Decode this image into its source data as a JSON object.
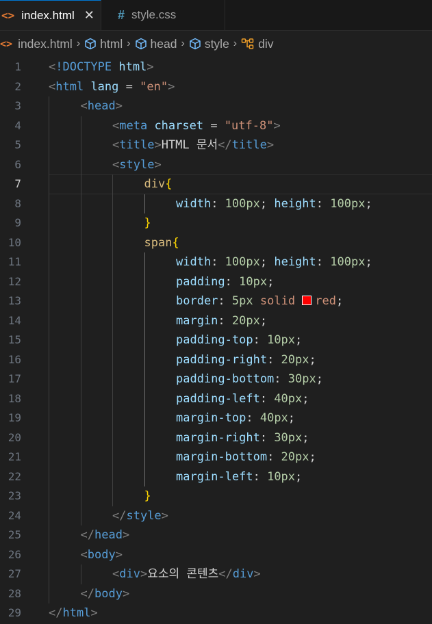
{
  "tabs": [
    {
      "label": "index.html",
      "icon": "html-file-icon",
      "active": true,
      "close": "✕"
    },
    {
      "label": "style.css",
      "icon": "css-file-icon",
      "active": false
    }
  ],
  "breadcrumb": [
    "index.html",
    "html",
    "head",
    "style",
    "div"
  ],
  "colors": {
    "html_icon": "#e37933",
    "css_icon": "#519aba",
    "swatch": "#ff0000"
  },
  "current_line": 7,
  "lines": [
    {
      "n": "1",
      "indent": 0,
      "tokens": [
        [
          "punc",
          "<"
        ],
        [
          "tag",
          "!DOCTYPE "
        ],
        [
          "attr",
          "html"
        ],
        [
          "punc",
          ">"
        ]
      ]
    },
    {
      "n": "2",
      "indent": 0,
      "tokens": [
        [
          "punc",
          "<"
        ],
        [
          "tag",
          "html "
        ],
        [
          "attr",
          "lang"
        ],
        [
          "plain",
          " = "
        ],
        [
          "str",
          "\"en\""
        ],
        [
          "punc",
          ">"
        ]
      ]
    },
    {
      "n": "3",
      "indent": 1,
      "tokens": [
        [
          "punc",
          "<"
        ],
        [
          "tag",
          "head"
        ],
        [
          "punc",
          ">"
        ]
      ]
    },
    {
      "n": "4",
      "indent": 2,
      "tokens": [
        [
          "punc",
          "<"
        ],
        [
          "tag",
          "meta "
        ],
        [
          "attr",
          "charset"
        ],
        [
          "plain",
          " = "
        ],
        [
          "str",
          "\"utf-8\""
        ],
        [
          "punc",
          ">"
        ]
      ]
    },
    {
      "n": "5",
      "indent": 2,
      "tokens": [
        [
          "punc",
          "<"
        ],
        [
          "tag",
          "title"
        ],
        [
          "punc",
          ">"
        ],
        [
          "text",
          "HTML 문서"
        ],
        [
          "punc",
          "</"
        ],
        [
          "tag",
          "title"
        ],
        [
          "punc",
          ">"
        ]
      ]
    },
    {
      "n": "6",
      "indent": 2,
      "tokens": [
        [
          "punc",
          "<"
        ],
        [
          "tag",
          "style"
        ],
        [
          "punc",
          ">"
        ]
      ]
    },
    {
      "n": "7",
      "indent": 3,
      "tokens": [
        [
          "sel",
          "div"
        ],
        [
          "brace",
          "{"
        ]
      ]
    },
    {
      "n": "8",
      "indent": 4,
      "tokens": [
        [
          "prop",
          "width"
        ],
        [
          "plain",
          ": "
        ],
        [
          "num",
          "100px"
        ],
        [
          "plain",
          "; "
        ],
        [
          "prop",
          "height"
        ],
        [
          "plain",
          ": "
        ],
        [
          "num",
          "100px"
        ],
        [
          "plain",
          ";"
        ]
      ]
    },
    {
      "n": "9",
      "indent": 3,
      "tokens": [
        [
          "brace",
          "}"
        ]
      ]
    },
    {
      "n": "10",
      "indent": 3,
      "tokens": [
        [
          "sel",
          "span"
        ],
        [
          "brace",
          "{"
        ]
      ]
    },
    {
      "n": "11",
      "indent": 4,
      "tokens": [
        [
          "prop",
          "width"
        ],
        [
          "plain",
          ": "
        ],
        [
          "num",
          "100px"
        ],
        [
          "plain",
          "; "
        ],
        [
          "prop",
          "height"
        ],
        [
          "plain",
          ": "
        ],
        [
          "num",
          "100px"
        ],
        [
          "plain",
          ";"
        ]
      ]
    },
    {
      "n": "12",
      "indent": 4,
      "tokens": [
        [
          "prop",
          "padding"
        ],
        [
          "plain",
          ": "
        ],
        [
          "num",
          "10px"
        ],
        [
          "plain",
          ";"
        ]
      ]
    },
    {
      "n": "13",
      "indent": 4,
      "tokens": [
        [
          "prop",
          "border"
        ],
        [
          "plain",
          ": "
        ],
        [
          "num",
          "5px"
        ],
        [
          "plain",
          " "
        ],
        [
          "val",
          "solid "
        ],
        [
          "swatch",
          ""
        ],
        [
          "val",
          "red"
        ],
        [
          "plain",
          ";"
        ]
      ]
    },
    {
      "n": "14",
      "indent": 4,
      "tokens": [
        [
          "prop",
          "margin"
        ],
        [
          "plain",
          ": "
        ],
        [
          "num",
          "20px"
        ],
        [
          "plain",
          ";"
        ]
      ]
    },
    {
      "n": "15",
      "indent": 4,
      "tokens": [
        [
          "prop",
          "padding-top"
        ],
        [
          "plain",
          ": "
        ],
        [
          "num",
          "10px"
        ],
        [
          "plain",
          ";"
        ]
      ]
    },
    {
      "n": "16",
      "indent": 4,
      "tokens": [
        [
          "prop",
          "padding-right"
        ],
        [
          "plain",
          ": "
        ],
        [
          "num",
          "20px"
        ],
        [
          "plain",
          ";"
        ]
      ]
    },
    {
      "n": "17",
      "indent": 4,
      "tokens": [
        [
          "prop",
          "padding-bottom"
        ],
        [
          "plain",
          ": "
        ],
        [
          "num",
          "30px"
        ],
        [
          "plain",
          ";"
        ]
      ]
    },
    {
      "n": "18",
      "indent": 4,
      "tokens": [
        [
          "prop",
          "padding-left"
        ],
        [
          "plain",
          ": "
        ],
        [
          "num",
          "40px"
        ],
        [
          "plain",
          ";"
        ]
      ]
    },
    {
      "n": "19",
      "indent": 4,
      "tokens": [
        [
          "prop",
          "margin-top"
        ],
        [
          "plain",
          ": "
        ],
        [
          "num",
          "40px"
        ],
        [
          "plain",
          ";"
        ]
      ]
    },
    {
      "n": "20",
      "indent": 4,
      "tokens": [
        [
          "prop",
          "margin-right"
        ],
        [
          "plain",
          ": "
        ],
        [
          "num",
          "30px"
        ],
        [
          "plain",
          ";"
        ]
      ]
    },
    {
      "n": "21",
      "indent": 4,
      "tokens": [
        [
          "prop",
          "margin-bottom"
        ],
        [
          "plain",
          ": "
        ],
        [
          "num",
          "20px"
        ],
        [
          "plain",
          ";"
        ]
      ]
    },
    {
      "n": "22",
      "indent": 4,
      "tokens": [
        [
          "prop",
          "margin-left"
        ],
        [
          "plain",
          ": "
        ],
        [
          "num",
          "10px"
        ],
        [
          "plain",
          ";"
        ]
      ]
    },
    {
      "n": "23",
      "indent": 3,
      "tokens": [
        [
          "brace",
          "}"
        ]
      ]
    },
    {
      "n": "24",
      "indent": 2,
      "tokens": [
        [
          "punc",
          "</"
        ],
        [
          "tag",
          "style"
        ],
        [
          "punc",
          ">"
        ]
      ]
    },
    {
      "n": "25",
      "indent": 1,
      "tokens": [
        [
          "punc",
          "</"
        ],
        [
          "tag",
          "head"
        ],
        [
          "punc",
          ">"
        ]
      ]
    },
    {
      "n": "26",
      "indent": 1,
      "tokens": [
        [
          "punc",
          "<"
        ],
        [
          "tag",
          "body"
        ],
        [
          "punc",
          ">"
        ]
      ]
    },
    {
      "n": "27",
      "indent": 2,
      "tokens": [
        [
          "punc",
          "<"
        ],
        [
          "tag",
          "div"
        ],
        [
          "punc",
          ">"
        ],
        [
          "text",
          "요소의 콘텐츠"
        ],
        [
          "punc",
          "</"
        ],
        [
          "tag",
          "div"
        ],
        [
          "punc",
          ">"
        ]
      ]
    },
    {
      "n": "28",
      "indent": 1,
      "tokens": [
        [
          "punc",
          "</"
        ],
        [
          "tag",
          "body"
        ],
        [
          "punc",
          ">"
        ]
      ]
    },
    {
      "n": "29",
      "indent": 0,
      "tokens": [
        [
          "punc",
          "</"
        ],
        [
          "tag",
          "html"
        ],
        [
          "punc",
          ">"
        ]
      ]
    }
  ]
}
